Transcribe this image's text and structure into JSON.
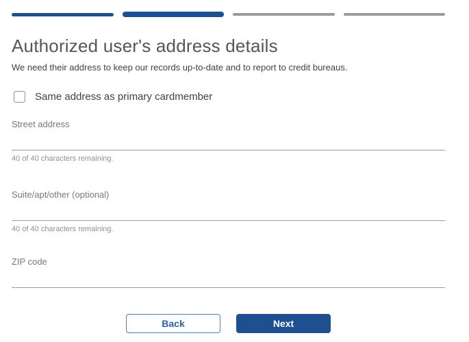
{
  "colors": {
    "primary_blue": "#1e4f91",
    "inactive_gray": "#9b9b9b",
    "heading_gray": "#54565b",
    "body_text": "#414042"
  },
  "progress": {
    "steps": [
      {
        "index": 1,
        "state": "complete"
      },
      {
        "index": 2,
        "state": "active"
      },
      {
        "index": 3,
        "state": "incomplete"
      },
      {
        "index": 4,
        "state": "incomplete"
      }
    ]
  },
  "header": {
    "title": "Authorized user's address details",
    "subtitle": "We need their address to keep our records up-to-date and to report to credit bureaus."
  },
  "form": {
    "same_address_checkbox": {
      "label": "Same address as primary cardmember",
      "checked": false
    },
    "fields": [
      {
        "label": "Street address",
        "value": "",
        "helper": "40 of 40 characters remaining."
      },
      {
        "label": "Suite/apt/other (optional)",
        "value": "",
        "helper": "40 of 40 characters remaining."
      },
      {
        "label": "ZIP code",
        "value": "",
        "helper": ""
      }
    ]
  },
  "buttons": {
    "back": "Back",
    "next": "Next"
  }
}
